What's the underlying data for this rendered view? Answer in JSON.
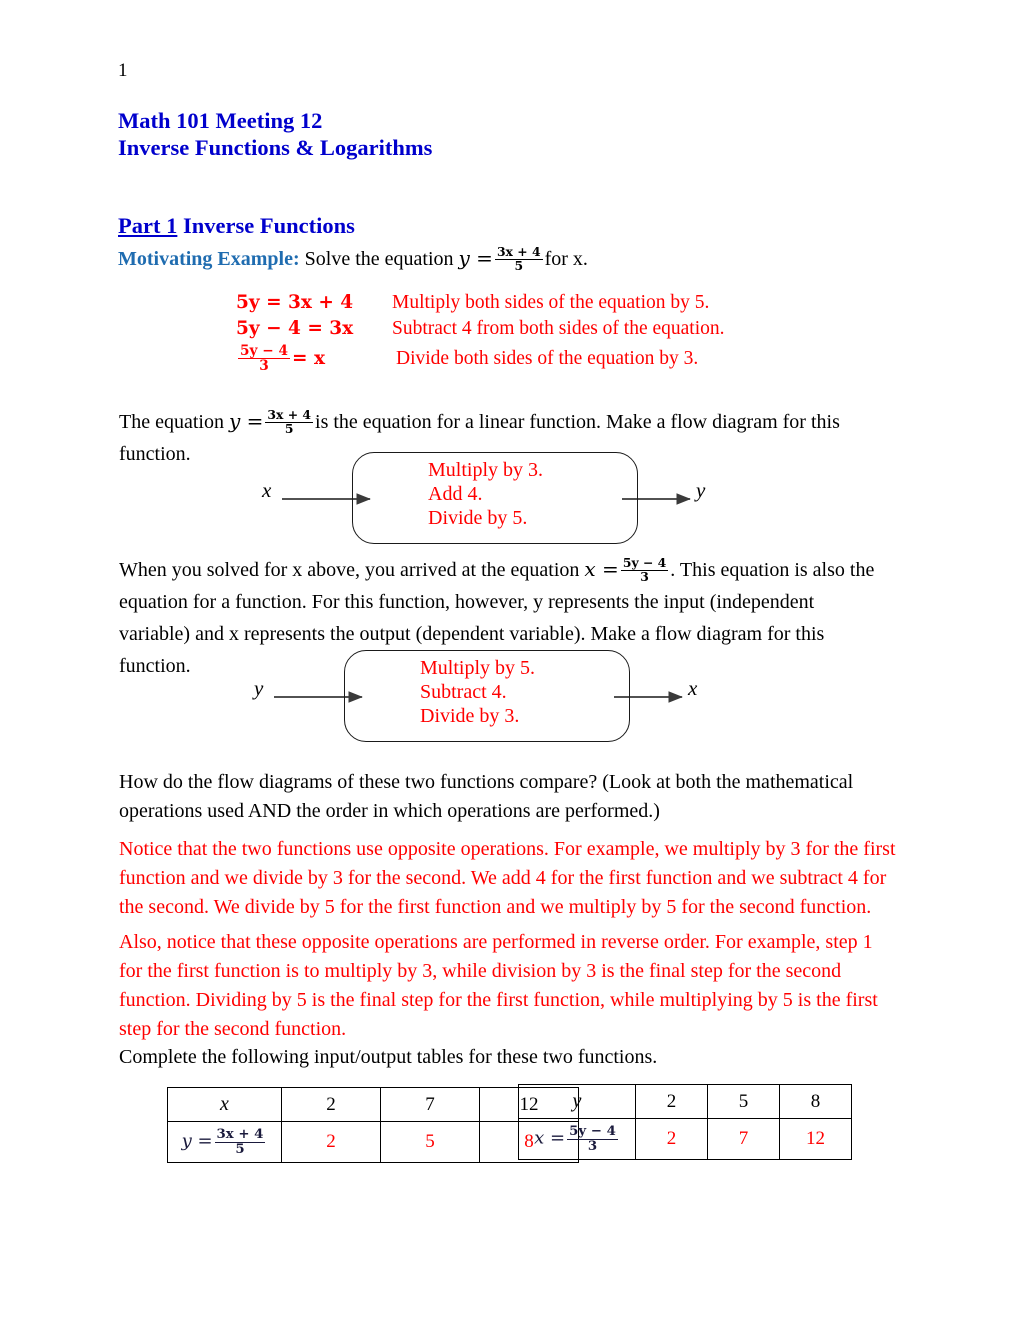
{
  "document": {
    "page_number": "1",
    "title_line1": "Math 101 Meeting 12",
    "title_line2": "Inverse Functions & Logarithms",
    "title_color": "#0000CC"
  },
  "part": {
    "label": "Part 1",
    "heading": "Inverse Functions",
    "motivating_lead": "Motivating Example:",
    "motivating_lead_color": "#1F6CB0",
    "motivating_text_before": "Solve the equation",
    "motivating_equation_lhs": "y =",
    "motivating_fraction_num": "3x + 4",
    "motivating_fraction_den": "5",
    "motivating_text_after": "for x."
  },
  "worked_example": {
    "color": "#FF0000",
    "steps": [
      {
        "equation": "5y = 3x + 4",
        "description": "Multiply both sides of the equation by 5."
      },
      {
        "equation": "5y − 4 = 3x",
        "description": "Subtract 4 from both sides of the equation."
      },
      {
        "equation_num": "5y − 4",
        "equation_den": "3",
        "equation_rhs": "= x",
        "description": "Divide both sides of the equation by 3."
      }
    ]
  },
  "paragraphs": {
    "linear_before": "The equation",
    "linear_frac_num": "3x + 4",
    "linear_frac_den": "5",
    "linear_lhs": "y =",
    "linear_after": "is the equation for a linear function. Make a flow diagram for this function.",
    "solved_before": "When you solved for x above, you arrived at the equation",
    "solved_lhs": "x =",
    "solved_frac_num": "5y − 4",
    "solved_frac_den": "3",
    "solved_after": ". This equation is also the equation for a function. For this function, however, y represents the input (independent variable) and x represents the output (dependent variable). Make a flow diagram for this function.",
    "compare_question": "How do the flow diagrams of these two functions compare? (Look at both the mathematical operations used AND the order in which operations are performed.)",
    "notice_answer": "Notice that the two functions use opposite operations. For example, we multiply by 3 for the first function and we divide by 3 for the second. We add 4 for the first function and we subtract 4 for the second. We divide by 5 for the first function and we multiply by 5 for the second function.",
    "also_answer": "Also, notice that these opposite operations are performed in reverse order.  For example, step 1 for the first function is to multiply by 3, while division by 3 is the final step for the second function. Dividing by 5 is the final step for the first function, while multiplying by 5 is the first step for the second function.",
    "complete_instruction": "Complete the following input/output tables for these two functions."
  },
  "flow_diagrams": [
    {
      "input_label": "x",
      "output_label": "y",
      "steps": [
        "Multiply by 3.",
        "Add 4.",
        "Divide by 5."
      ],
      "steps_color": "#FF0000"
    },
    {
      "input_label": "y",
      "output_label": "x",
      "steps": [
        "Multiply by 5.",
        "Subtract 4.",
        "Divide by 3."
      ],
      "steps_color": "#FF0000"
    }
  ],
  "tables": {
    "forward": {
      "header_label": "x",
      "header_values": [
        "2",
        "7",
        "12"
      ],
      "row_formula_lhs": "y =",
      "row_formula_num": "3x + 4",
      "row_formula_den": "5",
      "row_values": [
        "2",
        "5",
        "8"
      ],
      "answer_color": "#FF0000"
    },
    "inverse": {
      "header_label": "y",
      "header_values": [
        "2",
        "5",
        "8"
      ],
      "row_formula_lhs": "x =",
      "row_formula_num": "5y − 4",
      "row_formula_den": "3",
      "row_values": [
        "2",
        "7",
        "12"
      ],
      "answer_color": "#FF0000"
    }
  }
}
